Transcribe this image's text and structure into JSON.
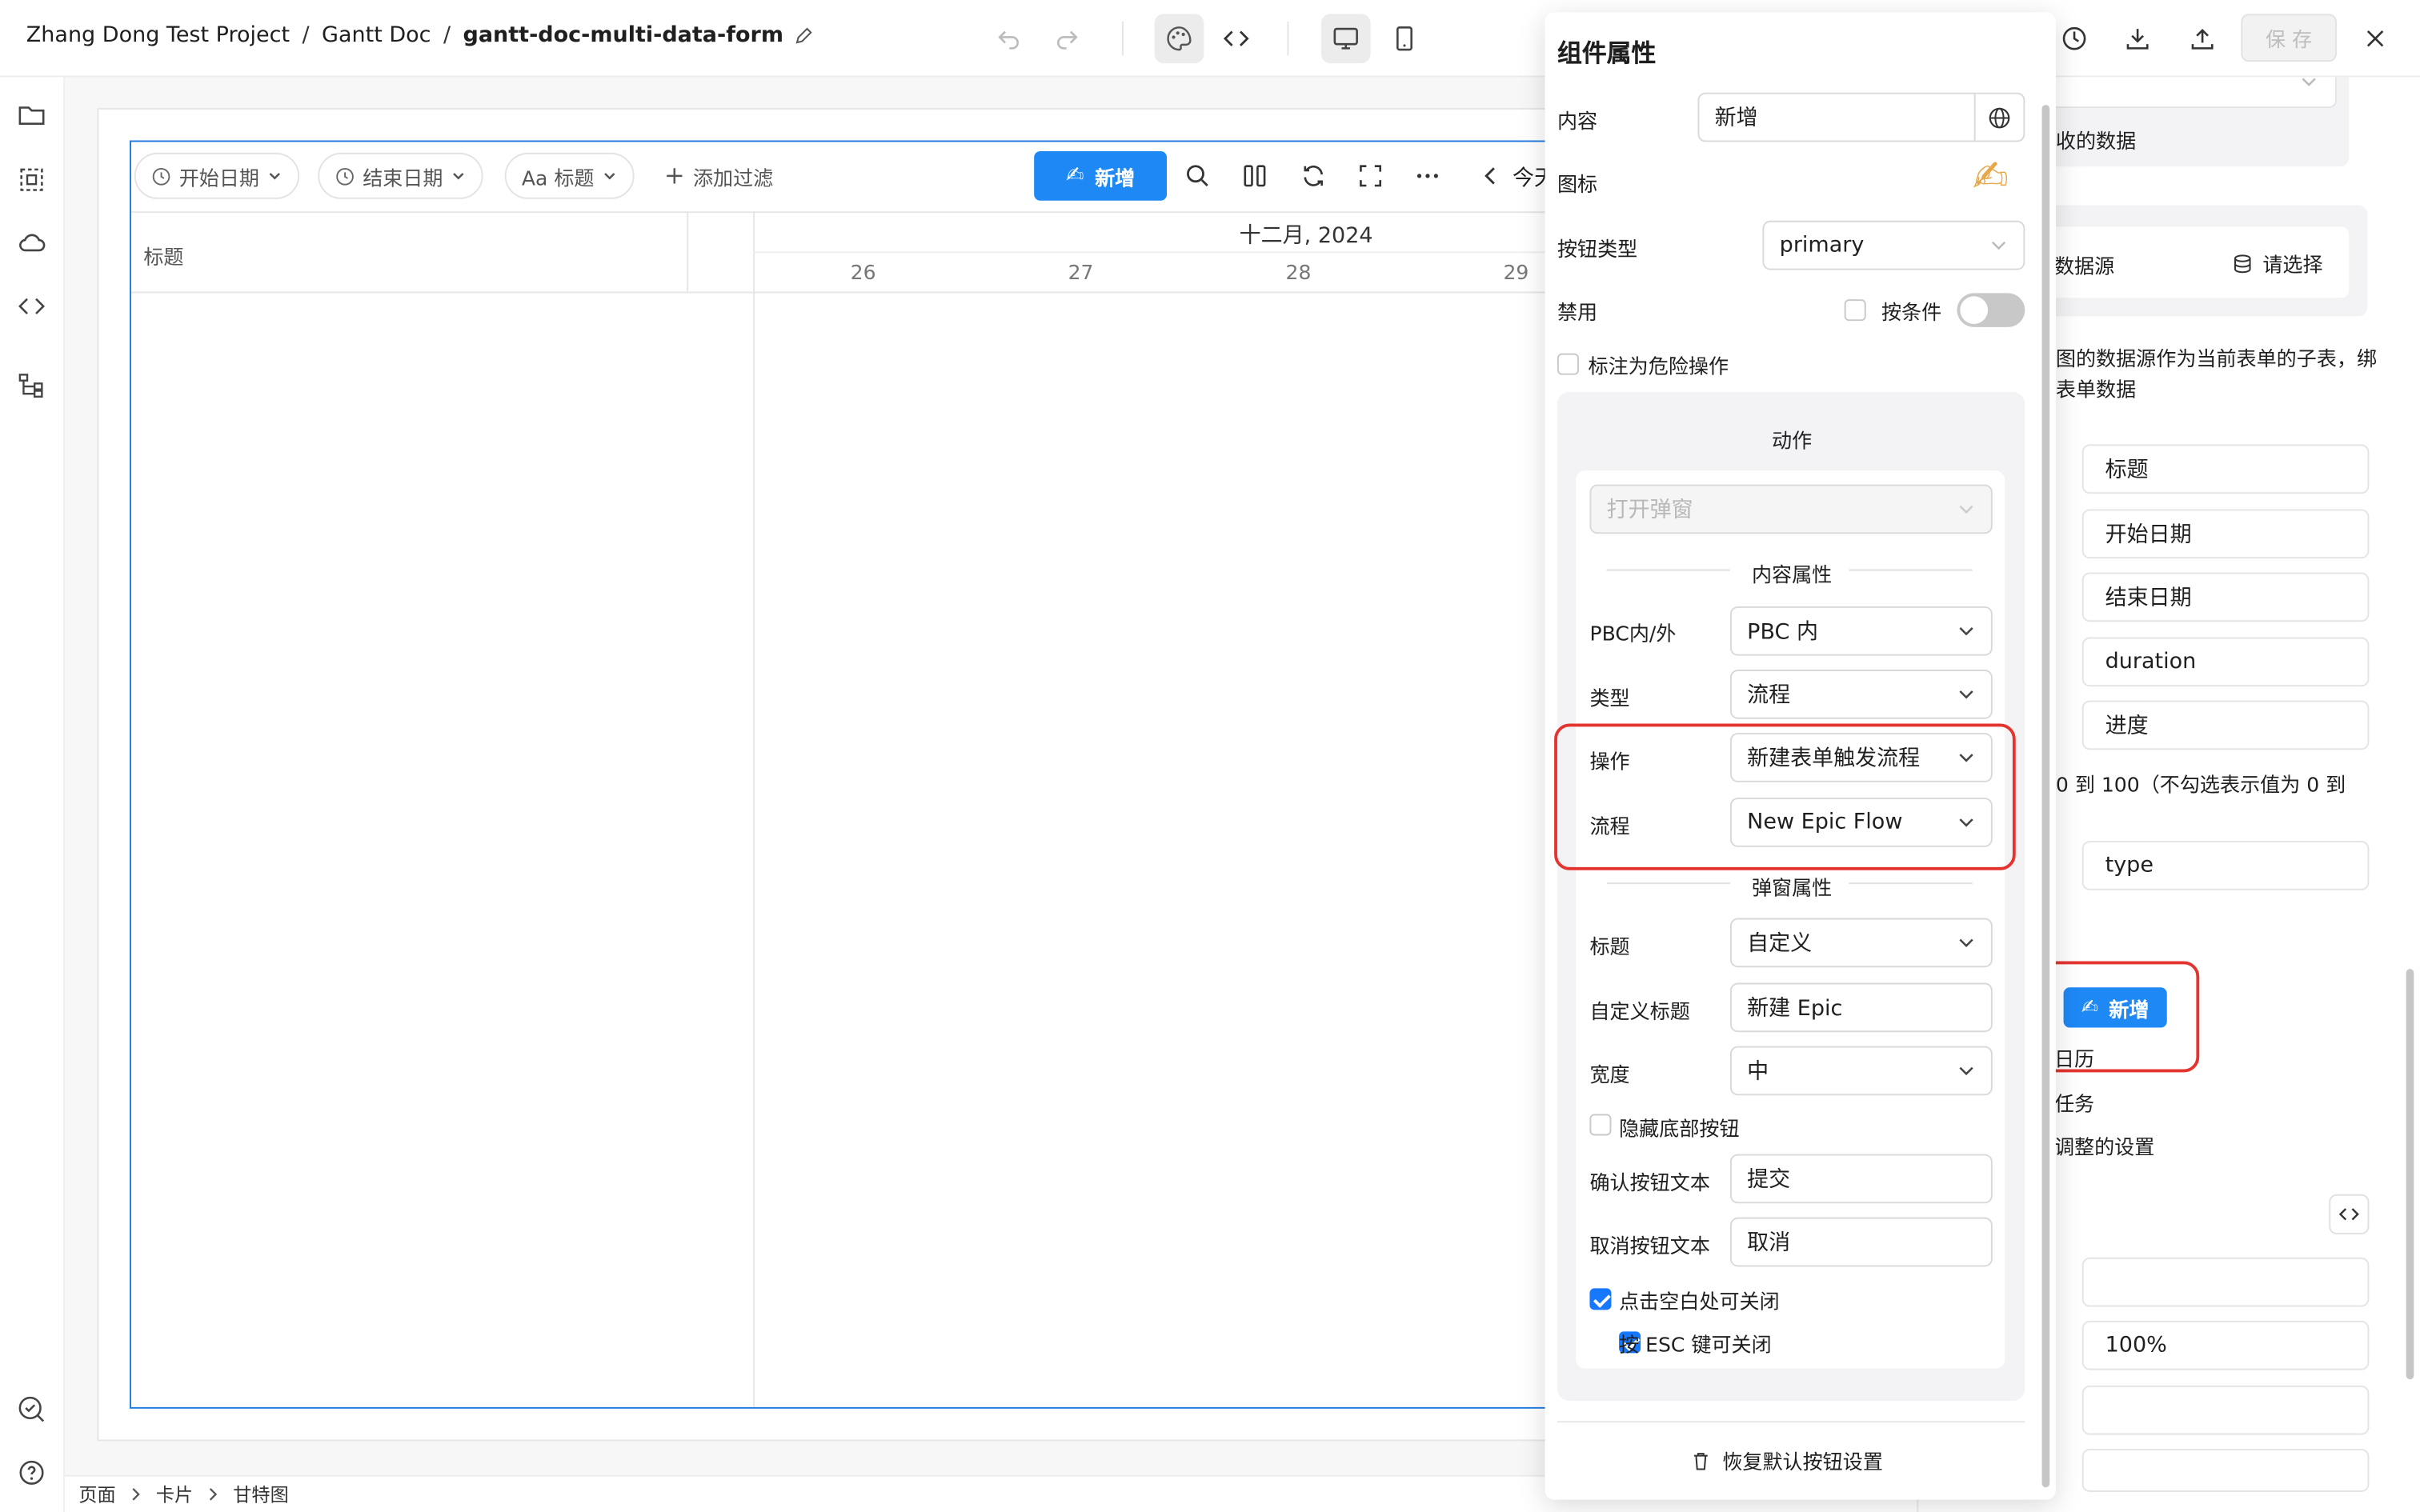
{
  "breadcrumb": {
    "project": "Zhang Dong Test Project",
    "doc": "Gantt Doc",
    "page": "gantt-doc-multi-data-form",
    "separator": "/"
  },
  "toolbar": {
    "save_label": "保 存"
  },
  "gantt": {
    "filters": {
      "start_date": "开始日期",
      "end_date": "结束日期",
      "title": "Aa 标题",
      "add_filter": "添加过滤"
    },
    "new_button": {
      "emoji": "✍",
      "label": "新增"
    },
    "today_label": "今天",
    "column_header": "标题",
    "month_label": "十二月, 2024",
    "days": [
      "26",
      "27",
      "28",
      "29"
    ]
  },
  "panel": {
    "title": "组件属性",
    "content_label": "内容",
    "content_value": "新增",
    "icon_label": "图标",
    "icon_emoji": "✍",
    "button_type_label": "按钮类型",
    "button_type_value": "primary",
    "disabled_label": "禁用",
    "by_condition_label": "按条件",
    "danger_label": "标注为危险操作",
    "action_section_title": "动作",
    "action_select": "打开弹窗",
    "content_props_divider": "内容属性",
    "pbc_label": "PBC内/外",
    "pbc_value": "PBC 内",
    "type_label": "类型",
    "type_value": "流程",
    "operation_label": "操作",
    "operation_value": "新建表单触发流程",
    "flow_label": "流程",
    "flow_value": "New Epic Flow",
    "popup_props_divider": "弹窗属性",
    "popup_title_label": "标题",
    "popup_title_value": "自定义",
    "custom_title_label": "自定义标题",
    "custom_title_value": "新建 Epic",
    "width_label": "宽度",
    "width_value": "中",
    "hide_footer_label": "隐藏底部按钮",
    "confirm_text_label": "确认按钮文本",
    "confirm_text_value": "提交",
    "cancel_text_label": "取消按钮文本",
    "cancel_text_value": "取消",
    "mask_close_label": "点击空白处可关闭",
    "esc_close_label": "按 ESC 键可关闭",
    "reset_label": "恢复默认按钮设置"
  },
  "right_panel": {
    "received_data": "收的数据",
    "datasource_label": "数据源",
    "select_placeholder": "请选择",
    "desc_line1": "图的数据源作为当前表单的子表，绑",
    "desc_line2": "表单数据",
    "fields": [
      "标题",
      "开始日期",
      "结束日期",
      "duration",
      "进度"
    ],
    "progress_note": "0 到 100（不勾选表示值为 0 到",
    "type_field": "type",
    "preview_button": "新增",
    "opt_calendar": "日历",
    "opt_task": "任务",
    "opt_adjust": "调整的设置",
    "percent_value": "100%"
  },
  "status_bar": {
    "items": [
      "页面",
      "卡片",
      "甘特图"
    ]
  },
  "colors": {
    "primary": "#1e88f5",
    "highlight": "#e3342f",
    "accent": "#1677ff"
  }
}
